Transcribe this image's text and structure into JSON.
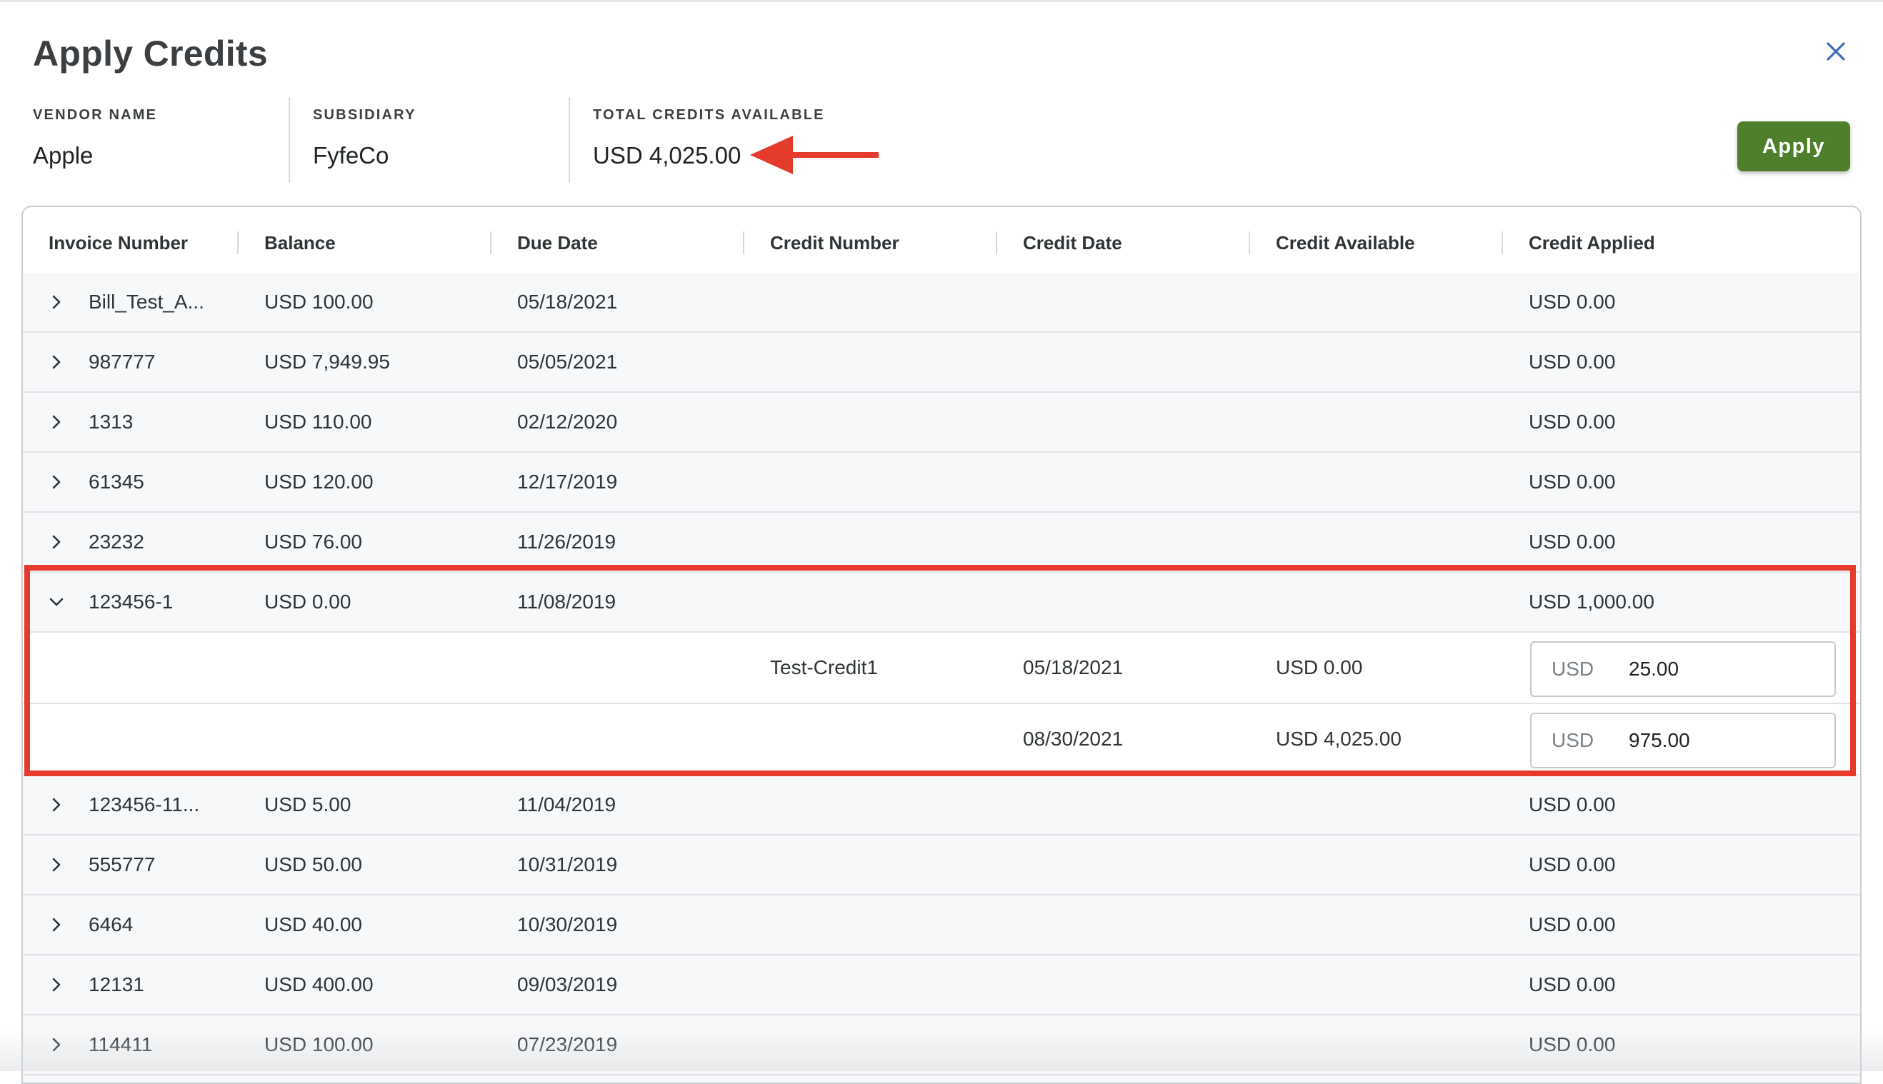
{
  "dialog": {
    "title": "Apply Credits",
    "apply_label": "Apply"
  },
  "info": {
    "vendor_label": "VENDOR NAME",
    "vendor_value": "Apple",
    "subsidiary_label": "SUBSIDIARY",
    "subsidiary_value": "FyfeCo",
    "total_label": "TOTAL CREDITS AVAILABLE",
    "total_value": "USD 4,025.00"
  },
  "columns": [
    "Invoice Number",
    "Balance",
    "Due Date",
    "Credit Number",
    "Credit Date",
    "Credit Available",
    "Credit Applied"
  ],
  "rows": [
    {
      "invoice": "Bill_Test_A...",
      "balance": "USD 100.00",
      "due": "05/18/2021",
      "applied": "USD 0.00"
    },
    {
      "invoice": "987777",
      "balance": "USD 7,949.95",
      "due": "05/05/2021",
      "applied": "USD 0.00"
    },
    {
      "invoice": "1313",
      "balance": "USD 110.00",
      "due": "02/12/2020",
      "applied": "USD 0.00"
    },
    {
      "invoice": "61345",
      "balance": "USD 120.00",
      "due": "12/17/2019",
      "applied": "USD 0.00"
    },
    {
      "invoice": "23232",
      "balance": "USD 76.00",
      "due": "11/26/2019",
      "applied": "USD 0.00"
    },
    {
      "invoice": "123456-1",
      "balance": "USD 0.00",
      "due": "11/08/2019",
      "applied": "USD 1,000.00"
    }
  ],
  "credits": [
    {
      "number": "Test-Credit1",
      "date": "05/18/2021",
      "available": "USD 0.00",
      "currency": "USD",
      "amount": "25.00"
    },
    {
      "number": "",
      "date": "08/30/2021",
      "available": "USD 4,025.00",
      "currency": "USD",
      "amount": "975.00"
    }
  ],
  "rows_after": [
    {
      "invoice": "123456-11...",
      "balance": "USD 5.00",
      "due": "11/04/2019",
      "applied": "USD 0.00"
    },
    {
      "invoice": "555777",
      "balance": "USD 50.00",
      "due": "10/31/2019",
      "applied": "USD 0.00"
    },
    {
      "invoice": "6464",
      "balance": "USD 40.00",
      "due": "10/30/2019",
      "applied": "USD 0.00"
    },
    {
      "invoice": "12131",
      "balance": "USD 400.00",
      "due": "09/03/2019",
      "applied": "USD 0.00"
    },
    {
      "invoice": "114411",
      "balance": "USD 100.00",
      "due": "07/23/2019",
      "applied": "USD 0.00"
    }
  ],
  "icons": {
    "close": "close-icon",
    "expand": "chevron-right-icon",
    "collapse": "chevron-down-icon"
  },
  "colors": {
    "apply_button": "#4f7f2c",
    "annotation": "#e53b2c",
    "close_icon": "#3d6fb8"
  }
}
